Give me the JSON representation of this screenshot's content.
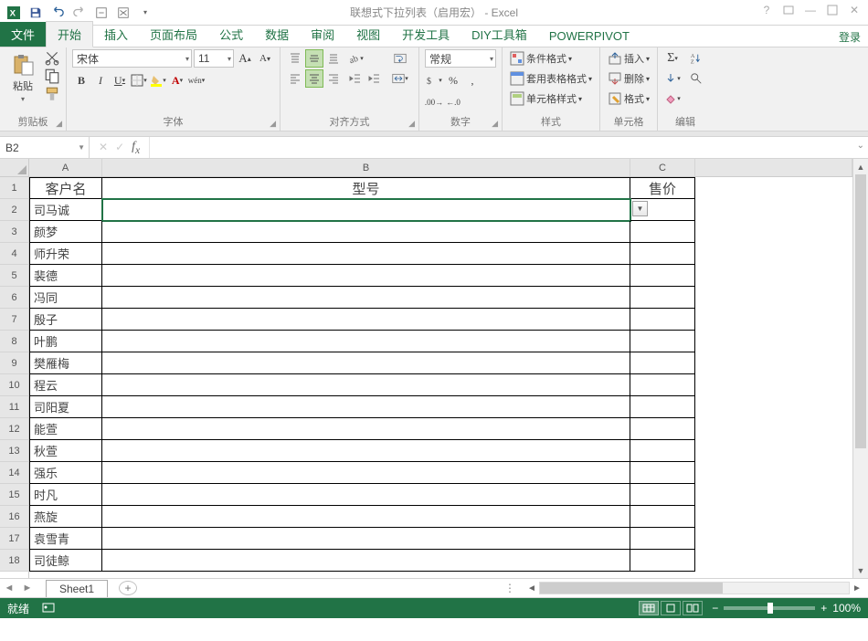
{
  "title": "联想式下拉列表（启用宏） - Excel",
  "login": "登录",
  "tabs": {
    "file": "文件",
    "items": [
      "开始",
      "插入",
      "页面布局",
      "公式",
      "数据",
      "审阅",
      "视图",
      "开发工具",
      "DIY工具箱",
      "POWERPIVOT"
    ],
    "active": 0
  },
  "ribbon": {
    "clipboard": {
      "paste": "粘贴",
      "label": "剪贴板"
    },
    "font": {
      "name": "宋体",
      "size": "11",
      "label": "字体"
    },
    "align": {
      "label": "对齐方式"
    },
    "number": {
      "format": "常规",
      "label": "数字"
    },
    "styles": {
      "cond": "条件格式",
      "tablefmt": "套用表格格式",
      "cellstyle": "单元格样式",
      "label": "样式"
    },
    "cells": {
      "insert": "插入",
      "delete": "删除",
      "format": "格式",
      "label": "单元格"
    },
    "editing": {
      "label": "编辑"
    }
  },
  "namebox": "B2",
  "columns": [
    "A",
    "B",
    "C"
  ],
  "headers": {
    "a": "客户名",
    "b": "型号",
    "c": "售价"
  },
  "rows": [
    {
      "n": 1
    },
    {
      "n": 2,
      "a": "司马诚"
    },
    {
      "n": 3,
      "a": "颜梦"
    },
    {
      "n": 4,
      "a": "师升荣"
    },
    {
      "n": 5,
      "a": "裴德"
    },
    {
      "n": 6,
      "a": "冯同"
    },
    {
      "n": 7,
      "a": "殷子"
    },
    {
      "n": 8,
      "a": "叶鹏"
    },
    {
      "n": 9,
      "a": "樊雁梅"
    },
    {
      "n": 10,
      "a": "程云"
    },
    {
      "n": 11,
      "a": "司阳夏"
    },
    {
      "n": 12,
      "a": "能萱"
    },
    {
      "n": 13,
      "a": "秋萱"
    },
    {
      "n": 14,
      "a": "强乐"
    },
    {
      "n": 15,
      "a": "时凡"
    },
    {
      "n": 16,
      "a": "燕旋"
    },
    {
      "n": 17,
      "a": "袁雪青"
    },
    {
      "n": 18,
      "a": "司徒鲸"
    }
  ],
  "sheet": "Sheet1",
  "status": {
    "ready": "就绪",
    "zoom": "100%"
  }
}
